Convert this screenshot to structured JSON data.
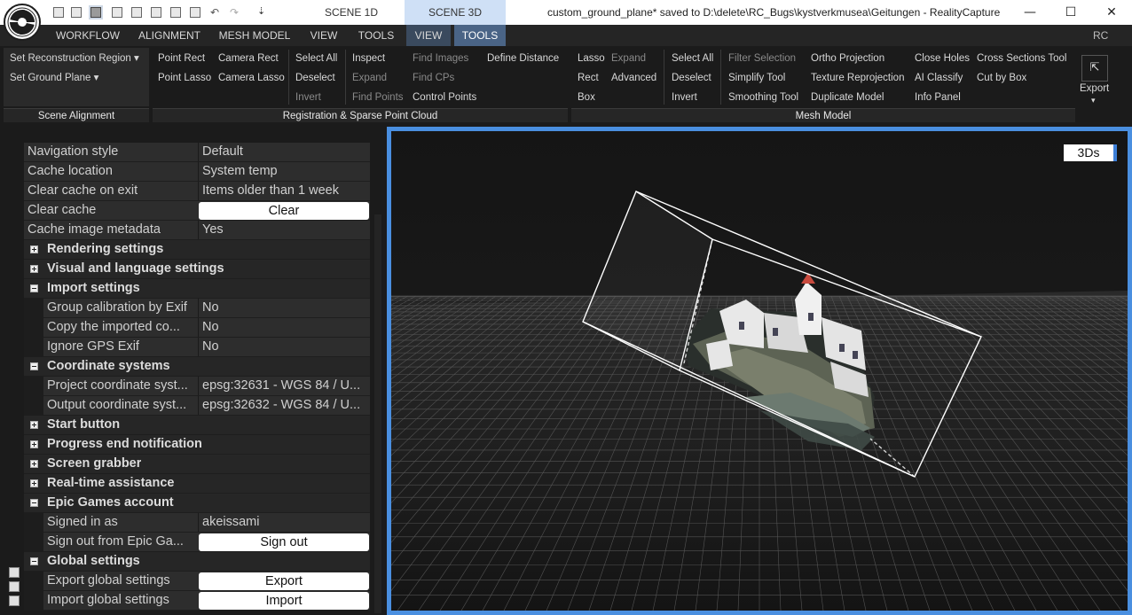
{
  "titlebar": {
    "scene_tabs": [
      "SCENE 1D",
      "SCENE 3D"
    ],
    "window_title": "custom_ground_plane* saved to D:\\delete\\RC_Bugs\\kystverkmusea\\Geitungen - RealityCapture",
    "more_glyph": "⇣",
    "minimize_glyph": "—",
    "maximize_glyph": "☐",
    "close_glyph": "✕",
    "undo_glyph": "↶",
    "redo_glyph": "↷"
  },
  "menubar": {
    "items": [
      "WORKFLOW",
      "ALIGNMENT",
      "MESH MODEL",
      "VIEW",
      "TOOLS",
      "VIEW",
      "TOOLS"
    ],
    "rc_label": "RC"
  },
  "ribbon": {
    "scene_alignment": {
      "set_reconstruction_region": "Set Reconstruction Region",
      "set_ground_plane": "Set Ground Plane",
      "label": "Scene Alignment"
    },
    "registration": {
      "point_rect": "Point Rect",
      "point_lasso": "Point Lasso",
      "camera_rect": "Camera Rect",
      "camera_lasso": "Camera Lasso",
      "select_all": "Select All",
      "deselect": "Deselect",
      "invert": "Invert",
      "inspect": "Inspect",
      "expand": "Expand",
      "find_points": "Find Points",
      "find_images": "Find Images",
      "find_cps": "Find CPs",
      "control_points": "Control Points",
      "define_distance": "Define Distance",
      "label": "Registration & Sparse Point Cloud"
    },
    "mesh_model": {
      "lasso": "Lasso",
      "rect": "Rect",
      "box": "Box",
      "expand": "Expand",
      "advanced": "Advanced",
      "select_all": "Select All",
      "deselect": "Deselect",
      "invert": "Invert",
      "filter_selection": "Filter Selection",
      "simplify_tool": "Simplify Tool",
      "smoothing_tool": "Smoothing Tool",
      "ortho_projection": "Ortho Projection",
      "texture_reprojection": "Texture Reprojection",
      "duplicate_model": "Duplicate Model",
      "close_holes": "Close Holes",
      "ai_classify": "AI Classify",
      "info_panel": "Info Panel",
      "cross_sections_tool": "Cross Sections Tool",
      "cut_by_box": "Cut by Box",
      "label": "Mesh Model"
    },
    "export": {
      "label": "Export",
      "icon_glyph": "⇱"
    }
  },
  "settings": {
    "navigation_style": {
      "label": "Navigation style",
      "value": "Default"
    },
    "cache_location": {
      "label": "Cache location",
      "value": "System temp"
    },
    "clear_cache_on_exit": {
      "label": "Clear cache on exit",
      "value": "Items older than 1 week"
    },
    "clear_cache": {
      "label": "Clear cache",
      "button": "Clear"
    },
    "cache_image_metadata": {
      "label": "Cache image metadata",
      "value": "Yes"
    },
    "rendering_settings": "Rendering settings",
    "visual_language_settings": "Visual and language settings",
    "import_settings": "Import settings",
    "group_calibration": {
      "label": "Group calibration by Exif",
      "value": "No"
    },
    "copy_imported": {
      "label": "Copy the imported co...",
      "value": "No"
    },
    "ignore_gps": {
      "label": "Ignore GPS Exif",
      "value": "No"
    },
    "coordinate_systems": "Coordinate systems",
    "project_coord": {
      "label": "Project coordinate syst...",
      "value": "epsg:32631 - WGS 84 / U..."
    },
    "output_coord": {
      "label": "Output coordinate syst...",
      "value": "epsg:32632 - WGS 84 / U..."
    },
    "start_button": "Start button",
    "progress_end": "Progress end notification",
    "screen_grabber": "Screen grabber",
    "realtime_assistance": "Real-time assistance",
    "epic_games_account": "Epic Games account",
    "signed_in_as": {
      "label": "Signed in as",
      "value": "akeissami"
    },
    "sign_out": {
      "label": "Sign out from Epic Ga...",
      "button": "Sign out"
    },
    "global_settings": "Global settings",
    "export_global": {
      "label": "Export global settings",
      "button": "Export"
    },
    "import_global": {
      "label": "Import global settings",
      "button": "Import"
    }
  },
  "viewport": {
    "mode_badge": "3Ds"
  },
  "colors": {
    "viewport_border": "#4a8fe0",
    "active_menu": "#4a6486",
    "scene_tab_active": "#cfe0f6"
  }
}
